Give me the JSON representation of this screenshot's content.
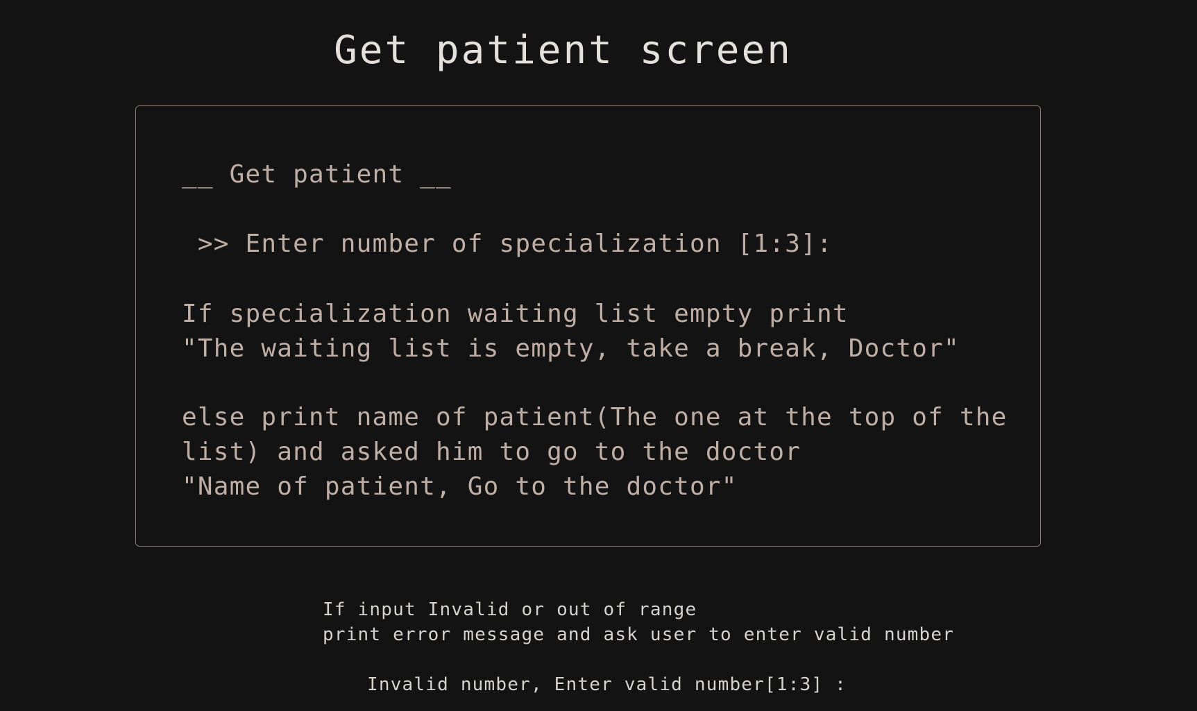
{
  "title": "Get patient screen",
  "console": {
    "heading": "__ Get patient __",
    "prompt": " >> Enter number of specialization [1:3]:",
    "empty_condition": "If specialization waiting list empty print",
    "empty_message": "\"The waiting list is empty, take a break, Doctor\"",
    "else_line_1": "else print name of patient(The one at the top of the",
    "else_line_2": "list) and asked him to go to the doctor",
    "else_message": "\"Name of patient, Go to the doctor\""
  },
  "note": {
    "line_1": "If input Invalid or out of range",
    "line_2": "print error message and ask user to enter valid number",
    "error_message": "Invalid number, Enter valid number[1:3] :"
  }
}
